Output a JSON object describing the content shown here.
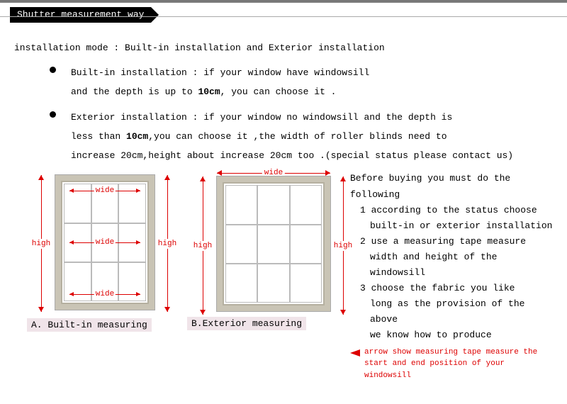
{
  "header": {
    "title": "Shutter measurement way"
  },
  "intro": "installation mode : Built-in installation and Exterior installation",
  "bullets": {
    "builtin": {
      "l1a": "Built-in installation : if your window have windowsill",
      "l2a": "and the depth is up to ",
      "depth": "10cm",
      "l2b": ", you can choose it ."
    },
    "exterior": {
      "l1": "Exterior installation : if your window no windowsill and the depth is",
      "l2a": "less than ",
      "depth": "10cm",
      "l2b": ",you can choose it ,the width of roller blinds need to",
      "l3": "increase 20cm,height about increase 20cm too .(special status please contact us)"
    }
  },
  "labels": {
    "wide": "wide",
    "high": "high"
  },
  "captions": {
    "a": "A. Built-in measuring",
    "b": "B.Exterior measuring"
  },
  "steps": {
    "pre": "Before buying you must do the following",
    "s1": "1 according to the status choose",
    "s1b": "built-in or exterior installation",
    "s2": "2 use a measuring tape measure",
    "s2b": "width and height of the windowsill",
    "s3": "3 choose the fabric you like",
    "s3b": "long as the provision of the above",
    "s3c": "we know how to produce"
  },
  "arrow_note": {
    "l1": "arrow show measuring tape measure the",
    "l2": "start and end position of your windowsill"
  }
}
